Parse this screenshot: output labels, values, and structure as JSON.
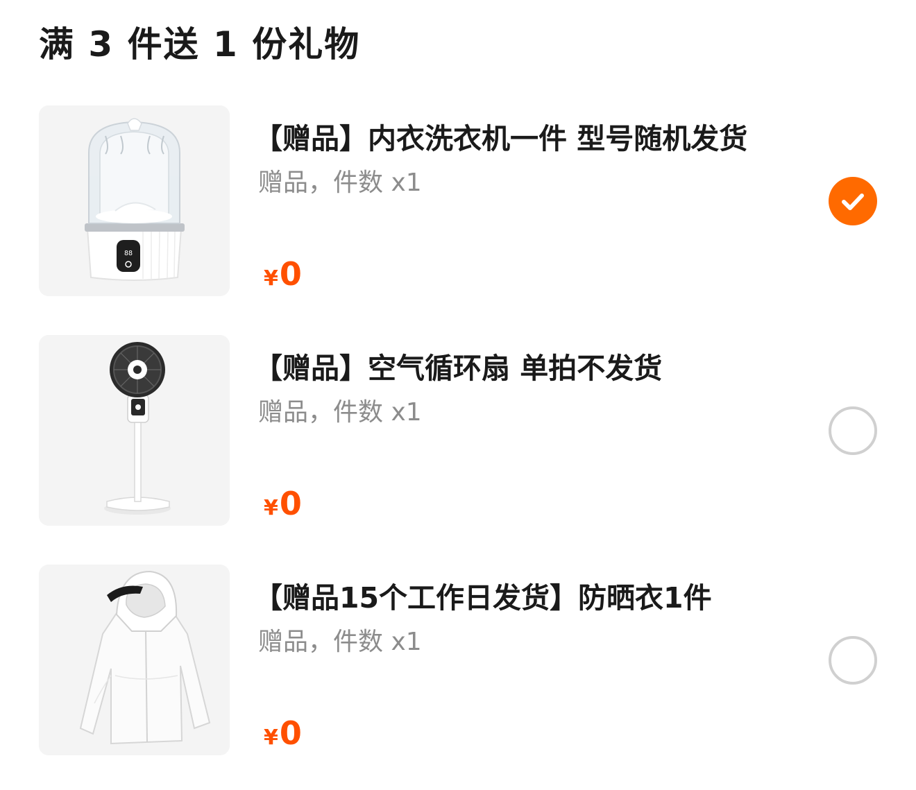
{
  "header": {
    "title": "满 3 件送 1 份礼物"
  },
  "colors": {
    "accent": "#ff6a00",
    "price": "#ff5000",
    "muted": "#8c8c8c",
    "radio_border": "#d0d0d0"
  },
  "items": [
    {
      "title": "【赠品】内衣洗衣机一件 型号随机发货",
      "subtitle": "赠品，件数 x1",
      "currency": "¥",
      "price": "0",
      "selected": true,
      "image_icon": "washing-machine-image",
      "device_display": "88"
    },
    {
      "title": "【赠品】空气循环扇 单拍不发货",
      "subtitle": "赠品，件数 x1",
      "currency": "¥",
      "price": "0",
      "selected": false,
      "image_icon": "fan-image"
    },
    {
      "title": "【赠品15个工作日发货】防晒衣1件",
      "subtitle": "赠品，件数 x1",
      "currency": "¥",
      "price": "0",
      "selected": false,
      "image_icon": "sun-jacket-image"
    }
  ]
}
